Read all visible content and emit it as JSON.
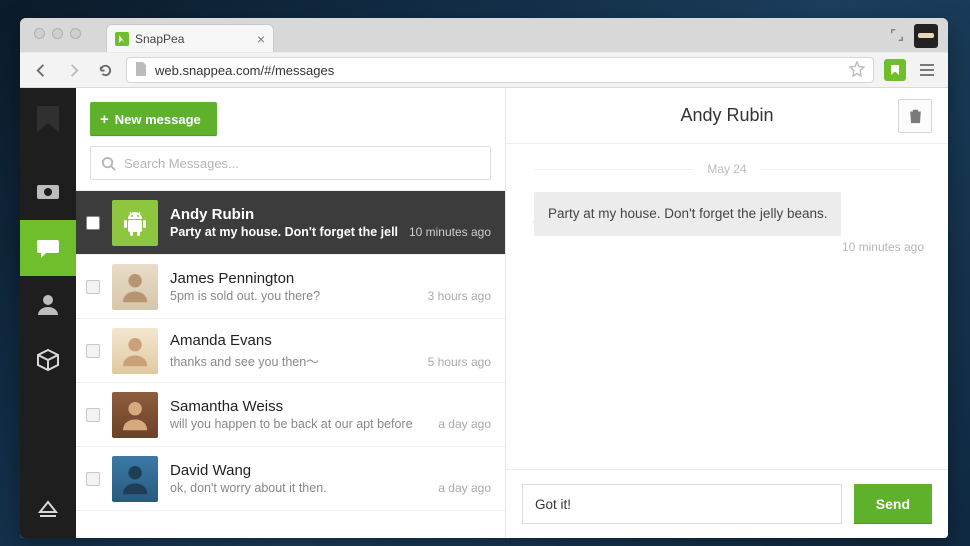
{
  "browser": {
    "tab_title": "SnapPea",
    "url": "web.snappea.com/#/messages"
  },
  "list_pane": {
    "new_message_label": "New message",
    "search_placeholder": "Search Messages..."
  },
  "threads": [
    {
      "name": "Andy Rubin",
      "preview": "Party at my house. Don't forget the jell",
      "time": "10 minutes ago",
      "selected": true,
      "avatar": "android"
    },
    {
      "name": "James Pennington",
      "preview": "5pm is sold out. you there?",
      "time": "3 hours ago",
      "selected": false,
      "avatar": "james"
    },
    {
      "name": "Amanda Evans",
      "preview": "thanks and see you then～",
      "time": "5 hours ago",
      "selected": false,
      "avatar": "amanda"
    },
    {
      "name": "Samantha Weiss",
      "preview": "will you happen to be back at our apt before",
      "time": "a day ago",
      "selected": false,
      "avatar": "sam"
    },
    {
      "name": "David Wang",
      "preview": "ok, don't worry about it then.",
      "time": "a day ago",
      "selected": false,
      "avatar": "david"
    }
  ],
  "conversation": {
    "title": "Andy Rubin",
    "date": "May 24",
    "messages": [
      {
        "text": "Party at my house. Don't forget the jelly beans.",
        "time": "10 minutes ago"
      }
    ],
    "composer_value": "Got it!",
    "send_label": "Send"
  },
  "colors": {
    "accent": "#5fb02b",
    "sidebar": "#1e1e1e"
  }
}
